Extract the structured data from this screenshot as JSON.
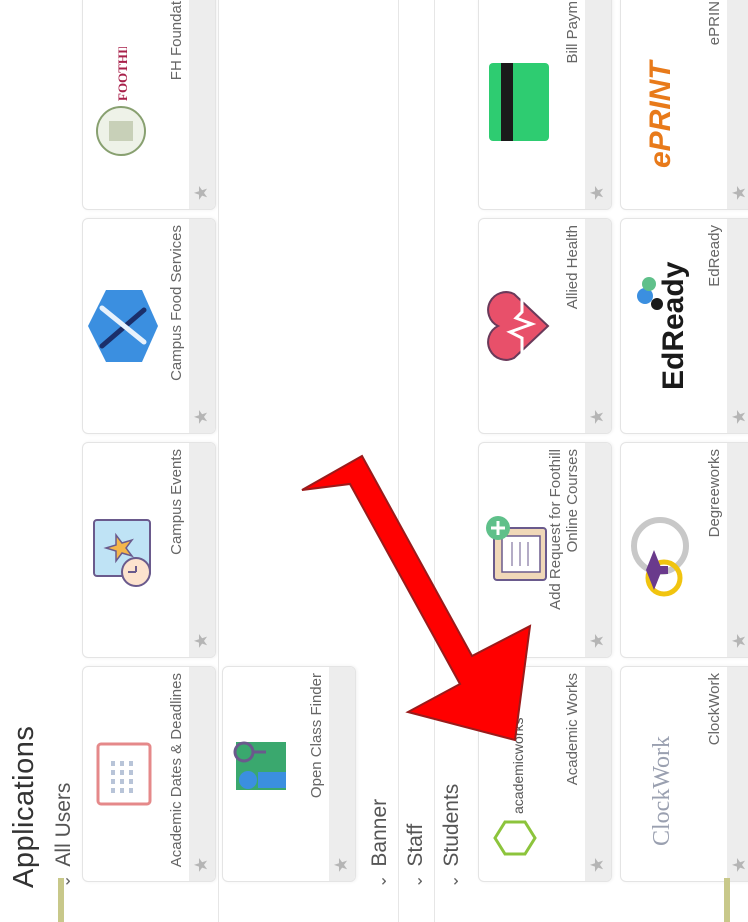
{
  "page": {
    "title": "Applications"
  },
  "sections": {
    "all_users": "All Users",
    "banner": "Banner",
    "staff": "Staff",
    "students": "Students"
  },
  "tiles": {
    "academic_dates": "Academic Dates & Deadlines",
    "campus_events": "Campus Events",
    "campus_food": "Campus Food Services",
    "fh_foundation": "FH Foundat",
    "open_class": "Open Class Finder",
    "academic_works": "Academic Works",
    "add_request": "Add Request for Foothill Online Courses",
    "allied_health": "Allied Health",
    "bill_payment": "Bill Paym",
    "clockwork": "ClockWork",
    "degreeworks": "Degreeworks",
    "edready": "EdReady",
    "eprint": "ePRIN"
  },
  "logos": {
    "foundation": "FOOTHILL-DE ANZA FOUNDATION",
    "academicworks": "academicworks",
    "clockwork": "ClockWork",
    "edready": "EdReady",
    "eprint": "ePRINT"
  },
  "colors": {
    "arrow": "#ff0000",
    "accent": "#c8c88a"
  },
  "icons": {
    "star": "star-icon",
    "chevron": "chevron-down-icon"
  }
}
